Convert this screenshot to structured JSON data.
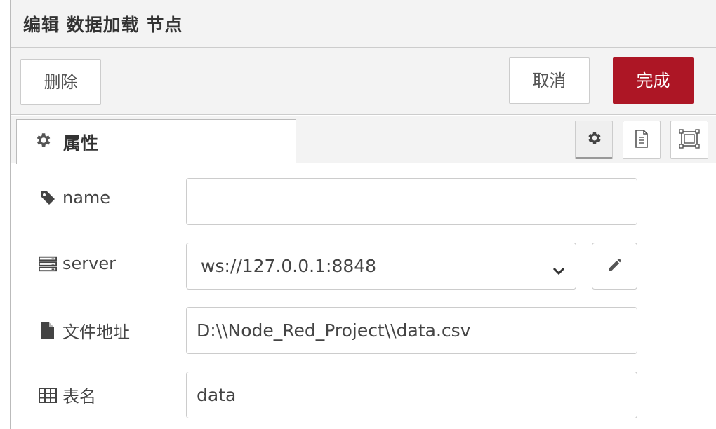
{
  "header": {
    "title": "编辑 数据加载 节点"
  },
  "toolbar": {
    "delete_label": "删除",
    "cancel_label": "取消",
    "done_label": "完成",
    "done_color": "#ad1625"
  },
  "tabs": {
    "active_label": "属性",
    "active_icon": "gear-icon",
    "buttons": [
      {
        "icon": "gear-icon",
        "selected": true
      },
      {
        "icon": "document-icon",
        "selected": false
      },
      {
        "icon": "frame-icon",
        "selected": false
      }
    ]
  },
  "form": {
    "name": {
      "label": "name",
      "icon": "tag-icon",
      "value": ""
    },
    "server": {
      "label": "server",
      "icon": "server-icon",
      "value": "ws://127.0.0.1:8848"
    },
    "file_path": {
      "label": "文件地址",
      "icon": "file-icon",
      "value": "D:\\\\Node_Red_Project\\\\data.csv"
    },
    "table_name": {
      "label": "表名",
      "icon": "table-icon",
      "value": "data"
    }
  }
}
